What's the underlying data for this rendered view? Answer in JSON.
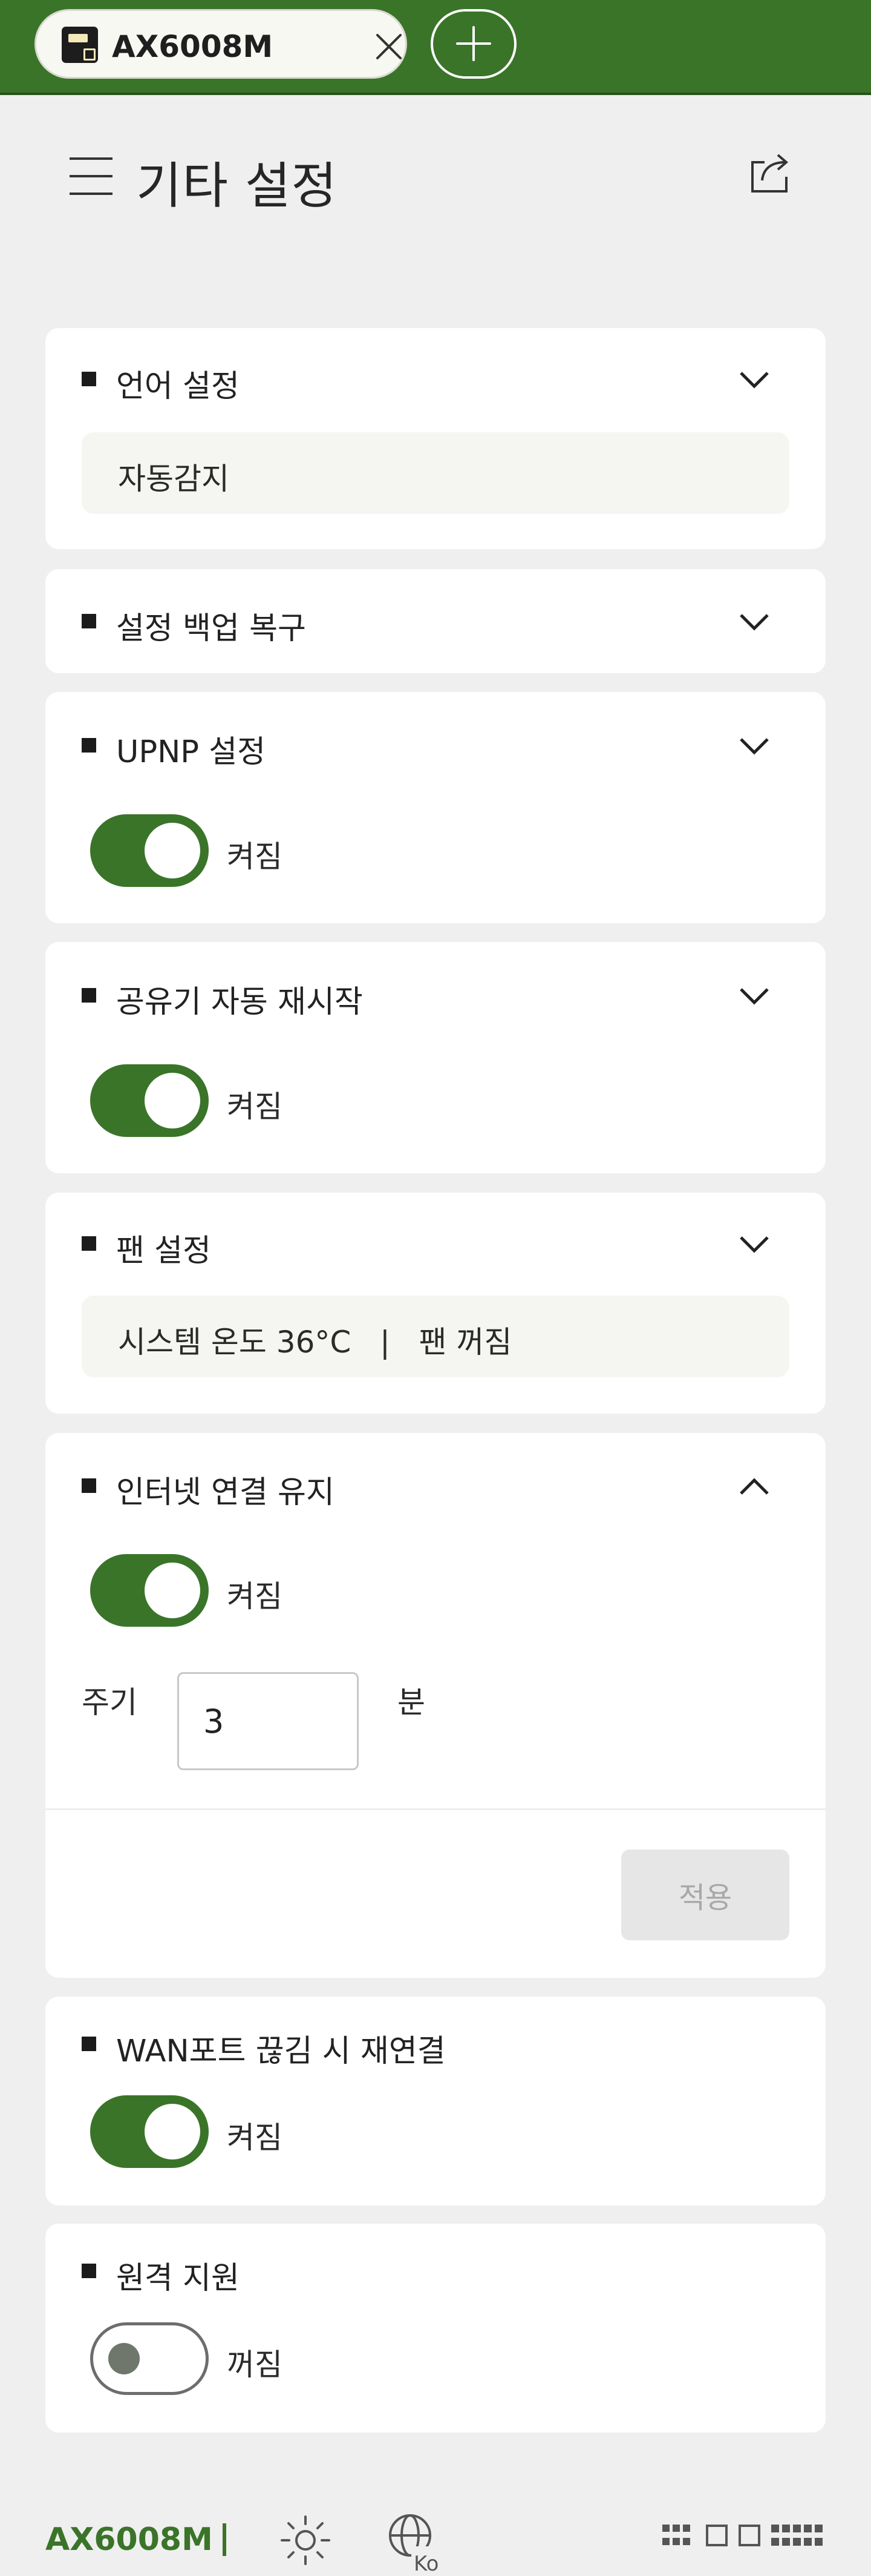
{
  "tab": {
    "title": "AX6008M"
  },
  "header": {
    "title": "기타 설정"
  },
  "cards": {
    "language": {
      "title": "언어 설정",
      "value": "자동감지"
    },
    "backup": {
      "title": "설정 백업 복구"
    },
    "upnp": {
      "title": "UPNP 설정",
      "state": "켜짐"
    },
    "auto_restart": {
      "title": "공유기 자동 재시작",
      "state": "켜짐"
    },
    "fan": {
      "title": "팬 설정",
      "value": "시스템 온도 36°C   |   팬 꺼짐"
    },
    "keepalive": {
      "title": "인터넷 연결 유지",
      "state": "켜짐",
      "period_label": "주기",
      "period_value": "3",
      "unit": "분",
      "apply_label": "적용"
    },
    "wan_reconnect": {
      "title": "WAN포트 끊김 시 재연결",
      "state": "켜짐"
    },
    "remote_support": {
      "title": "원격 지원",
      "state": "꺼짐"
    }
  },
  "footer": {
    "brand": "AX6008M",
    "separator": "|",
    "lang_code": "Ko"
  },
  "colors": {
    "accent": "#3a7429",
    "background": "#efefef",
    "card": "#ffffff"
  }
}
